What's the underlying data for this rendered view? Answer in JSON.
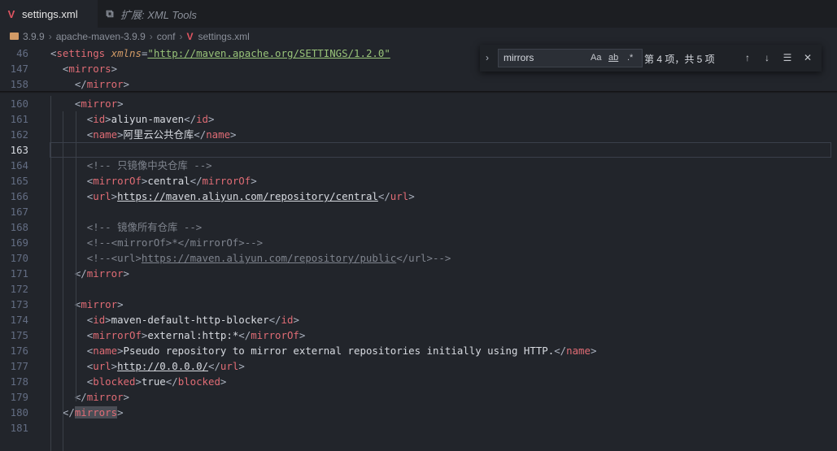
{
  "tabs": [
    {
      "label": "settings.xml",
      "icon": "maven-v-icon",
      "active": true
    },
    {
      "label": "扩展: XML Tools",
      "icon": "extension-icon",
      "active": false
    }
  ],
  "breadcrumb": [
    "3.9.9",
    "apache-maven-3.9.9",
    "conf",
    "settings.xml"
  ],
  "find": {
    "query": "mirrors",
    "match_case": "Aa",
    "whole_word": "ab",
    "regex": ".*",
    "count": "第 4 项，共 5 项"
  },
  "current_line": "163",
  "lines": [
    {
      "n": "46",
      "html": "<span class='p'>&lt;</span><span class='t'>settings</span> <span class='a'>xmlns</span><span class='p'>=</span><span class='s'>\"http://maven.apache.org/SETTINGS/1.2.0\"</span>"
    },
    {
      "n": "147",
      "html": "  <span class='p'>&lt;</span><span class='t'>mirrors</span><span class='p'>&gt;</span>"
    },
    {
      "n": "158",
      "html": "    <span class='p'>&lt;/</span><span class='t'>mirror</span><span class='p'>&gt;</span>"
    },
    {
      "n": "160",
      "html": "    <span class='p'>&lt;</span><span class='t'>mirror</span><span class='p'>&gt;</span>"
    },
    {
      "n": "161",
      "html": "      <span class='p'>&lt;</span><span class='t'>id</span><span class='p'>&gt;</span>aliyun-maven<span class='p'>&lt;/</span><span class='t'>id</span><span class='p'>&gt;</span>"
    },
    {
      "n": "162",
      "html": "      <span class='p'>&lt;</span><span class='t'>name</span><span class='p'>&gt;</span>阿里云公共仓库<span class='p'>&lt;/</span><span class='t'>name</span><span class='p'>&gt;</span>"
    },
    {
      "n": "163",
      "html": ""
    },
    {
      "n": "164",
      "html": "      <span class='c'>&lt;!-- 只镜像中央仓库 --&gt;</span>"
    },
    {
      "n": "165",
      "html": "      <span class='p'>&lt;</span><span class='t'>mirrorOf</span><span class='p'>&gt;</span>central<span class='p'>&lt;/</span><span class='t'>mirrorOf</span><span class='p'>&gt;</span>"
    },
    {
      "n": "166",
      "html": "      <span class='p'>&lt;</span><span class='t'>url</span><span class='p'>&gt;</span><span class='u'>https://maven.aliyun.com/repository/central</span><span class='p'>&lt;/</span><span class='t'>url</span><span class='p'>&gt;</span>"
    },
    {
      "n": "167",
      "html": ""
    },
    {
      "n": "168",
      "html": "      <span class='c'>&lt;!-- 镜像所有仓库 --&gt;</span>"
    },
    {
      "n": "169",
      "html": "      <span class='c'>&lt;!--&lt;mirrorOf&gt;*&lt;/mirrorOf&gt;--&gt;</span>"
    },
    {
      "n": "170",
      "html": "      <span class='c'>&lt;!--&lt;url&gt;<span class='u'>https://maven.aliyun.com/repository/public</span>&lt;/url&gt;--&gt;</span>"
    },
    {
      "n": "171",
      "html": "    <span class='p'>&lt;/</span><span class='t'>mirror</span><span class='p'>&gt;</span>"
    },
    {
      "n": "172",
      "html": ""
    },
    {
      "n": "173",
      "html": "    <span class='p'>&lt;</span><span class='t'>mirror</span><span class='p'>&gt;</span>"
    },
    {
      "n": "174",
      "html": "      <span class='p'>&lt;</span><span class='t'>id</span><span class='p'>&gt;</span>maven-default-http-blocker<span class='p'>&lt;/</span><span class='t'>id</span><span class='p'>&gt;</span>"
    },
    {
      "n": "175",
      "html": "      <span class='p'>&lt;</span><span class='t'>mirrorOf</span><span class='p'>&gt;</span>external:http:*<span class='p'>&lt;/</span><span class='t'>mirrorOf</span><span class='p'>&gt;</span>"
    },
    {
      "n": "176",
      "html": "      <span class='p'>&lt;</span><span class='t'>name</span><span class='p'>&gt;</span>Pseudo repository to mirror external repositories initially using HTTP.<span class='p'>&lt;/</span><span class='t'>name</span><span class='p'>&gt;</span>"
    },
    {
      "n": "177",
      "html": "      <span class='p'>&lt;</span><span class='t'>url</span><span class='p'>&gt;</span><span class='u'>http://0.0.0.0/</span><span class='p'>&lt;/</span><span class='t'>url</span><span class='p'>&gt;</span>"
    },
    {
      "n": "178",
      "html": "      <span class='p'>&lt;</span><span class='t'>blocked</span><span class='p'>&gt;</span>true<span class='p'>&lt;/</span><span class='t'>blocked</span><span class='p'>&gt;</span>"
    },
    {
      "n": "179",
      "html": "    <span class='p'>&lt;/</span><span class='t'>mirror</span><span class='p'>&gt;</span>"
    },
    {
      "n": "180",
      "html": "  <span class='p'>&lt;/</span><span class='t hl'>mirrors</span><span class='p'>&gt;</span>"
    },
    {
      "n": "181",
      "html": ""
    }
  ]
}
